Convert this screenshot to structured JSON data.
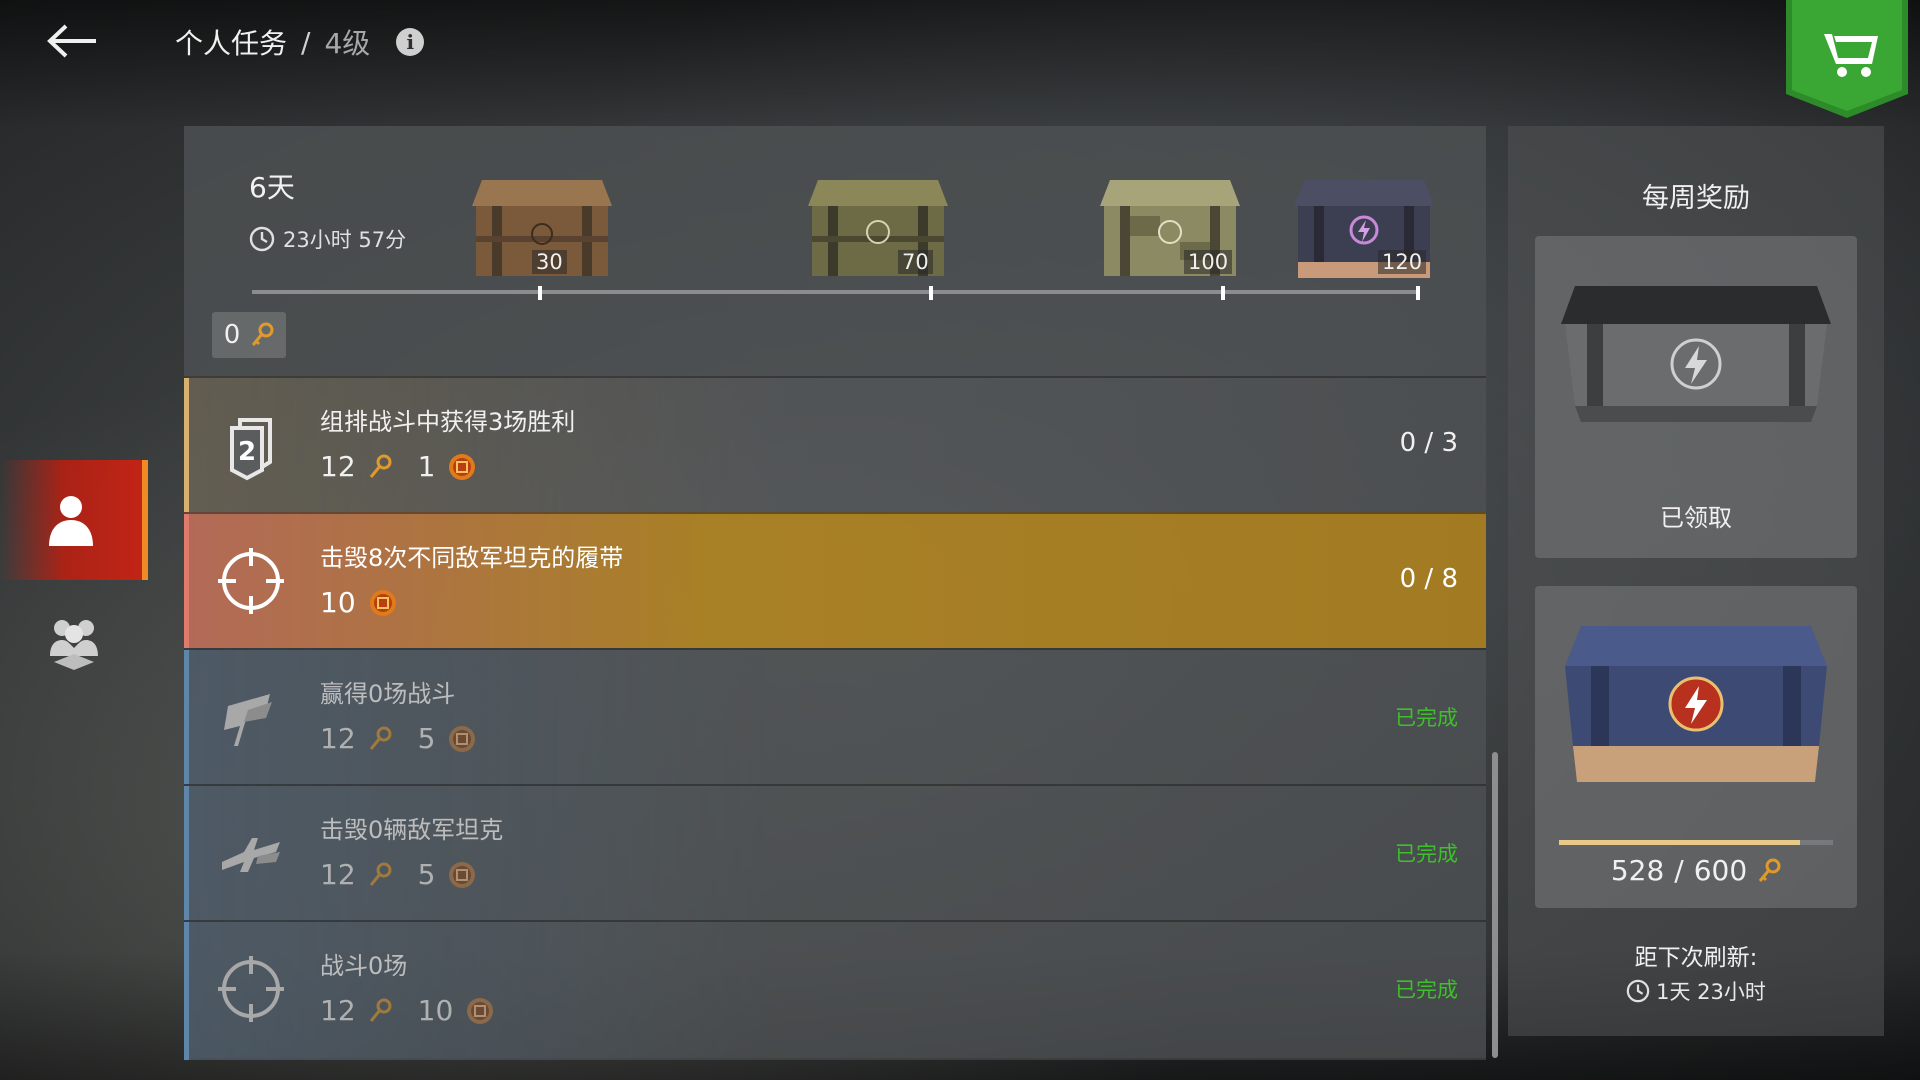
{
  "header": {
    "title": "个人任务",
    "separator": "/",
    "level": "4级"
  },
  "sidebar": {
    "items": [
      {
        "name": "personal-missions",
        "active": true
      },
      {
        "name": "clan-missions",
        "active": false
      }
    ]
  },
  "progress": {
    "days": "6天",
    "time": "23小时 57分",
    "keys": "0",
    "milestones": [
      "30",
      "70",
      "100",
      "120"
    ]
  },
  "tasks": [
    {
      "title": "组排战斗中获得3场胜利",
      "key_reward": "12",
      "coin_reward": "1",
      "status": "0 / 3",
      "icon": "platoon-icon"
    },
    {
      "title": "击毁8次不同敌军坦克的履带",
      "coin_reward": "10",
      "status": "0 / 8",
      "icon": "crosshair-icon"
    },
    {
      "title": "赢得0场战斗",
      "key_reward": "12",
      "coin_reward": "5",
      "status": "已完成",
      "icon": "victory-flag-icon"
    },
    {
      "title": "击毁0辆敌军坦克",
      "key_reward": "12",
      "coin_reward": "5",
      "status": "已完成",
      "icon": "destroy-tank-icon"
    },
    {
      "title": "战斗0场",
      "key_reward": "12",
      "coin_reward": "10",
      "status": "已完成",
      "icon": "crosshair-icon"
    }
  ],
  "weekly": {
    "title": "每周奖励",
    "claimed_label": "已领取",
    "progress_current": "528",
    "progress_sep": "/",
    "progress_total": "600",
    "progress_fraction": 0.88,
    "refresh_label": "距下次刷新:",
    "refresh_time": "1天 23小时"
  },
  "colors": {
    "accent_orange": "#f08a22",
    "active_red": "#c8261a",
    "highlight_gold": "#b28521",
    "complete_green": "#3fbf2c",
    "shop_green": "#2e8b2a"
  }
}
